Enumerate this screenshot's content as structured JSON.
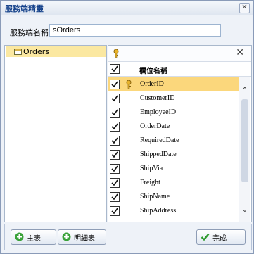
{
  "window": {
    "title": "服務端精靈",
    "close": "✕"
  },
  "name_field": {
    "label": "服務端名稱:",
    "value": "sOrders"
  },
  "tree": {
    "items": [
      {
        "label": "Orders"
      }
    ]
  },
  "grid": {
    "close": "✕",
    "header": "欄位名稱",
    "rows": [
      {
        "name": "OrderID",
        "checked": true,
        "key": true,
        "selected": true
      },
      {
        "name": "CustomerID",
        "checked": true,
        "key": false,
        "selected": false
      },
      {
        "name": "EmployeeID",
        "checked": true,
        "key": false,
        "selected": false
      },
      {
        "name": "OrderDate",
        "checked": true,
        "key": false,
        "selected": false
      },
      {
        "name": "RequiredDate",
        "checked": true,
        "key": false,
        "selected": false
      },
      {
        "name": "ShippedDate",
        "checked": true,
        "key": false,
        "selected": false
      },
      {
        "name": "ShipVia",
        "checked": true,
        "key": false,
        "selected": false
      },
      {
        "name": "Freight",
        "checked": true,
        "key": false,
        "selected": false
      },
      {
        "name": "ShipName",
        "checked": true,
        "key": false,
        "selected": false
      },
      {
        "name": "ShipAddress",
        "checked": true,
        "key": false,
        "selected": false
      }
    ]
  },
  "buttons": {
    "master": "主表",
    "detail": "明細表",
    "finish": "完成"
  },
  "icons": {
    "key": "key-icon",
    "add": "add-icon",
    "check": "check-icon",
    "table": "table-icon"
  },
  "colors": {
    "selected_row": "#fbd77c",
    "tree_selected": "#fbe8a1",
    "add_green": "#3aa23a",
    "check_green": "#2e9b2e"
  }
}
